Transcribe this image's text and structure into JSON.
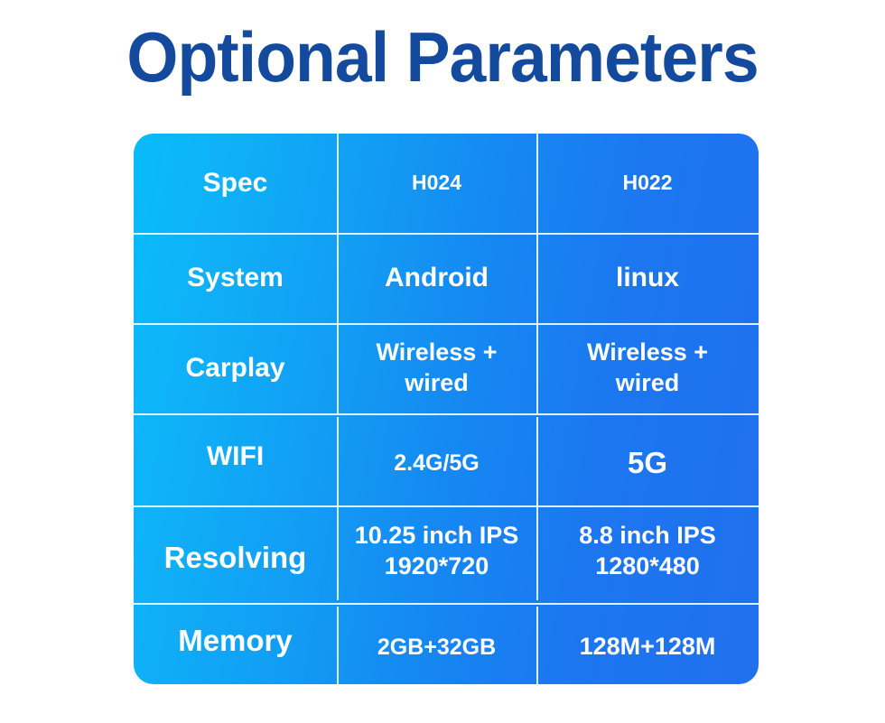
{
  "page": {
    "title": "Optional Parameters",
    "background_color": "#ffffff",
    "title_color": "#134A9E"
  },
  "table": {
    "gradient_from": "#08BCF8",
    "gradient_to": "#2170EE",
    "divider_color": "#ECFCFF",
    "text_color": "#FFFFFF",
    "columns": [
      "Spec",
      "H024",
      "H022"
    ],
    "rows": [
      {
        "label": "Spec",
        "h024": "H024",
        "h022": "H022"
      },
      {
        "label": "System",
        "h024": "Android",
        "h022": "linux"
      },
      {
        "label": "Carplay",
        "h024": "Wireless +\nwired",
        "h022": "Wireless +\nwired"
      },
      {
        "label": "WIFI",
        "h024": "2.4G/5G",
        "h022": "5G"
      },
      {
        "label": "Resolving",
        "h024": "10.25 inch IPS\n1920*720",
        "h022": "8.8 inch IPS\n1280*480"
      },
      {
        "label": "Memory",
        "h024": "2GB+32GB",
        "h022": "128M+128M"
      }
    ]
  }
}
